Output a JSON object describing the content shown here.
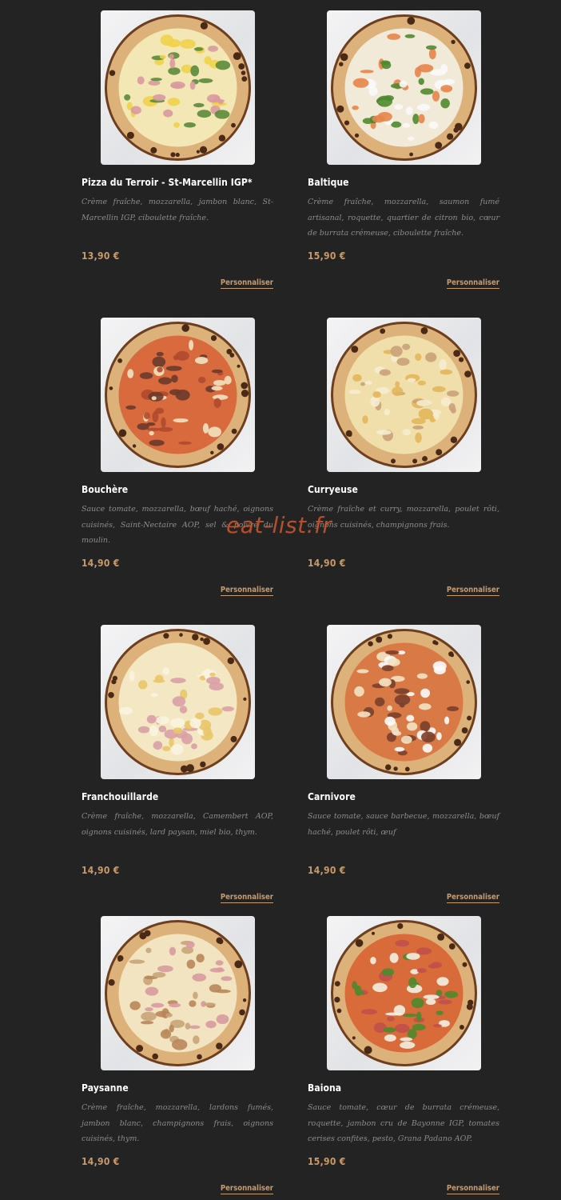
{
  "watermark": "eat-list.fr",
  "colors": {
    "background": "#232323",
    "accent": "#c99a6b",
    "name": "#ffffff",
    "description": "#8c8c8c",
    "watermark": "#d4572c"
  },
  "products": [
    {
      "name": "Pizza du Terroir - St-Marcellin IGP*",
      "description": "Crème fraîche, mozzarella, jambon blanc, St-Marcellin IGP, ciboulette fraîche.",
      "price": "13,90 €",
      "action": "Personnaliser",
      "pizza": {
        "sauce": "#f3e7b6",
        "toppings": [
          "#d99aa0",
          "#f0d24a",
          "#5b8a3a"
        ]
      }
    },
    {
      "name": "Baltique",
      "description": "Crème fraîche, mozzarella, saumon fumé artisanal, roquette, quartier de citron bio, cœur de burrata crémeuse, ciboulette fraîche.",
      "price": "15,90 €",
      "action": "Personnaliser",
      "pizza": {
        "sauce": "#f1ead8",
        "toppings": [
          "#e8844a",
          "#4f8a2f",
          "#fafafa"
        ]
      }
    },
    {
      "name": "Bouchère",
      "description": "Sauce tomate, mozzarella, bœuf haché, oignons cuisinés, Saint-Nectaire AOP, sel & poivre du moulin.",
      "price": "14,90 €",
      "action": "Personnaliser",
      "pizza": {
        "sauce": "#d86a3e",
        "toppings": [
          "#6b3a2a",
          "#f2e3c0",
          "#b04a2e"
        ]
      }
    },
    {
      "name": "Curryeuse",
      "description": "Crème fraîche et curry, mozzarella, poulet rôti, oignons cuisinés, champignons frais.",
      "price": "14,90 €",
      "action": "Personnaliser",
      "pizza": {
        "sauce": "#f0dfaa",
        "toppings": [
          "#e2b65a",
          "#c9a27a",
          "#f6eccf"
        ]
      }
    },
    {
      "name": "Franchouillarde",
      "description": "Crème fraîche, mozzarella, Camembert AOP, oignons cuisinés, lard paysan, miel bio, thym.",
      "price": "14,90 €",
      "action": "Personnaliser",
      "pizza": {
        "sauce": "#f4e8c4",
        "toppings": [
          "#d9a0a5",
          "#e9c56a",
          "#faf3df"
        ]
      }
    },
    {
      "name": "Carnivore",
      "description": "Sauce tomate, sauce barbecue, mozzarella, bœuf haché, poulet rôti, œuf",
      "price": "14,90 €",
      "action": "Personnaliser",
      "pizza": {
        "sauce": "#d97a46",
        "toppings": [
          "#7a3f2b",
          "#f3e2c2",
          "#fbfbfb"
        ]
      }
    },
    {
      "name": "Paysanne",
      "description": "Crème fraîche, mozzarella, lardons fumés, jambon blanc, champignons frais, oignons cuisinés, thym.",
      "price": "14,90 €",
      "action": "Personnaliser",
      "pizza": {
        "sauce": "#f2e4c0",
        "toppings": [
          "#d89aa0",
          "#c9a47a",
          "#b9865a"
        ]
      }
    },
    {
      "name": "Baiona",
      "description": "Sauce tomate, cœur de burrata crémeuse, roquette, jambon cru de Bayonne IGP, tomates cerises confites, pesto, Grana Padano AOP.",
      "price": "15,90 €",
      "action": "Personnaliser",
      "pizza": {
        "sauce": "#d96a3a",
        "toppings": [
          "#4e8a2e",
          "#c0504a",
          "#f4efe2"
        ]
      }
    }
  ]
}
